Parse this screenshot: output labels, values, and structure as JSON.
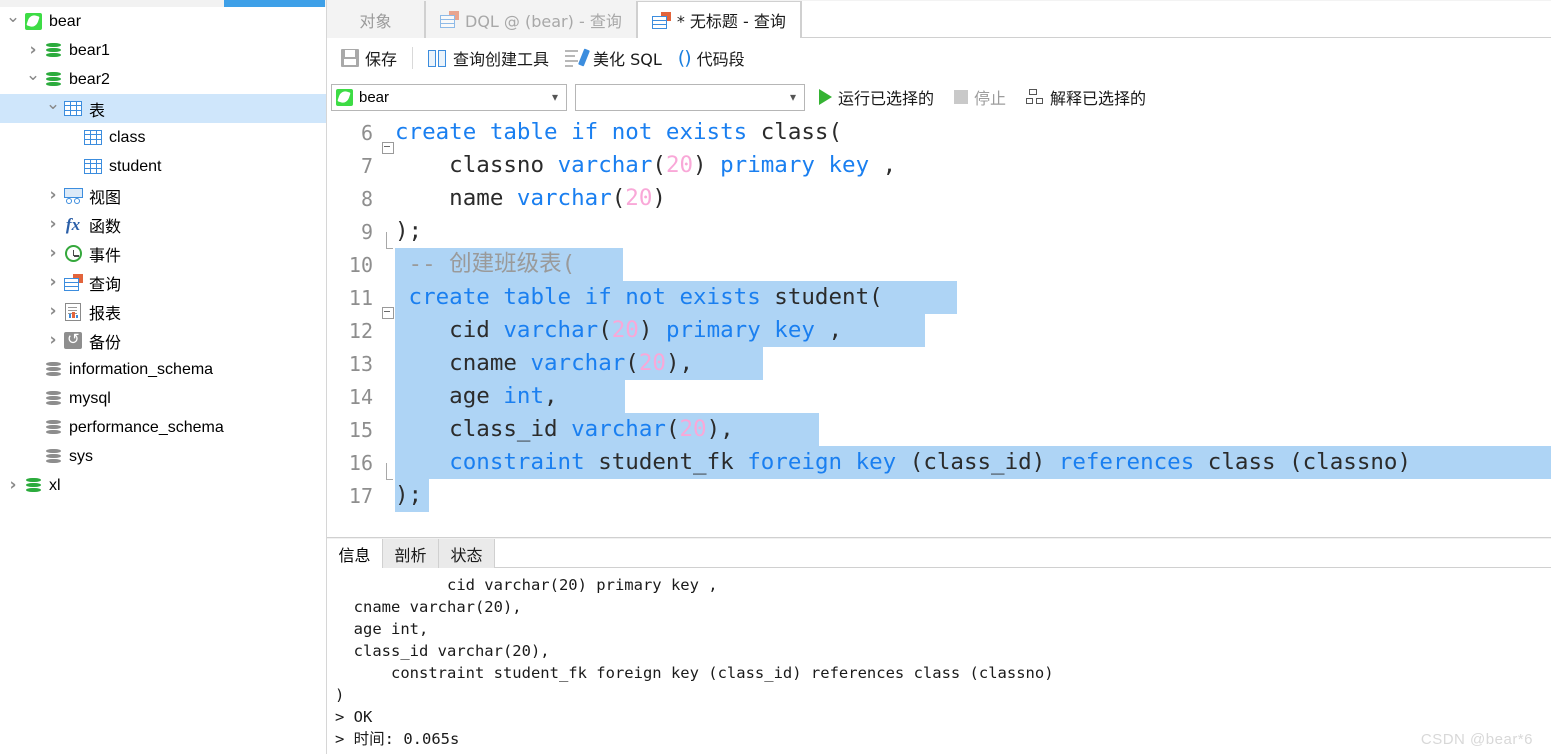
{
  "sidebar": {
    "scrollbar": {
      "name": "horizontal-scrollbar"
    },
    "items": [
      {
        "label": "bear",
        "icon": "dolphin-icon",
        "twist": "open",
        "indent": 0,
        "selected": false
      },
      {
        "label": "bear1",
        "icon": "database-green-icon",
        "twist": "closed",
        "indent": 1,
        "selected": false
      },
      {
        "label": "bear2",
        "icon": "database-green-icon",
        "twist": "open",
        "indent": 1,
        "selected": false
      },
      {
        "label": "表",
        "icon": "table-folder-icon",
        "twist": "open",
        "indent": 2,
        "selected": true
      },
      {
        "label": "class",
        "icon": "table-icon",
        "twist": "none",
        "indent": 3,
        "selected": false
      },
      {
        "label": "student",
        "icon": "table-icon",
        "twist": "none",
        "indent": 3,
        "selected": false
      },
      {
        "label": "视图",
        "icon": "view-icon",
        "twist": "closed",
        "indent": 2,
        "selected": false
      },
      {
        "label": "函数",
        "icon": "function-icon",
        "twist": "closed",
        "indent": 2,
        "selected": false
      },
      {
        "label": "事件",
        "icon": "event-clock-icon",
        "twist": "closed",
        "indent": 2,
        "selected": false
      },
      {
        "label": "查询",
        "icon": "query-icon",
        "twist": "closed",
        "indent": 2,
        "selected": false
      },
      {
        "label": "报表",
        "icon": "report-icon",
        "twist": "closed",
        "indent": 2,
        "selected": false
      },
      {
        "label": "备份",
        "icon": "backup-icon",
        "twist": "closed",
        "indent": 2,
        "selected": false
      },
      {
        "label": "information_schema",
        "icon": "database-gray-icon",
        "twist": "none",
        "indent": 1,
        "selected": false
      },
      {
        "label": "mysql",
        "icon": "database-gray-icon",
        "twist": "none",
        "indent": 1,
        "selected": false
      },
      {
        "label": "performance_schema",
        "icon": "database-gray-icon",
        "twist": "none",
        "indent": 1,
        "selected": false
      },
      {
        "label": "sys",
        "icon": "database-gray-icon",
        "twist": "none",
        "indent": 1,
        "selected": false
      },
      {
        "label": "xl",
        "icon": "database-green-icon",
        "twist": "closed",
        "indent": 0,
        "selected": false
      }
    ]
  },
  "tabs": [
    {
      "label": "对象",
      "icon": "none",
      "state": "objects"
    },
    {
      "label": "DQL @ (bear) - 查询",
      "icon": "query-icon",
      "state": "inactive"
    },
    {
      "label": "* 无标题 - 查询",
      "icon": "query-icon",
      "state": "active"
    }
  ],
  "toolbar": {
    "save_label": "保存",
    "query_builder_label": "查询创建工具",
    "beautify_label": "美化 SQL",
    "snippet_label": "代码段"
  },
  "connbar": {
    "connection_value": "bear",
    "database_value": "",
    "run_selected_label": "运行已选择的",
    "stop_label": "停止",
    "explain_selected_label": "解释已选择的"
  },
  "editor": {
    "first_line_number": 6,
    "lines": [
      {
        "n": 6,
        "fold": "box",
        "indent": 0,
        "tokens": [
          {
            "t": "create table if not exists ",
            "c": "kw"
          },
          {
            "t": "class(",
            "c": ""
          }
        ],
        "selected": false
      },
      {
        "n": 7,
        "fold": "bar",
        "indent": 0,
        "tokens": [
          {
            "t": "    classno ",
            "c": ""
          },
          {
            "t": "varchar",
            "c": "kw"
          },
          {
            "t": "(",
            "c": ""
          },
          {
            "t": "20",
            "c": "num"
          },
          {
            "t": ") ",
            "c": ""
          },
          {
            "t": "primary key",
            "c": "kw"
          },
          {
            "t": " ,",
            "c": ""
          }
        ],
        "selected": false
      },
      {
        "n": 8,
        "fold": "bar",
        "indent": 0,
        "tokens": [
          {
            "t": "    name ",
            "c": ""
          },
          {
            "t": "varchar",
            "c": "kw"
          },
          {
            "t": "(",
            "c": ""
          },
          {
            "t": "20",
            "c": "num"
          },
          {
            "t": ")",
            "c": ""
          }
        ],
        "selected": false
      },
      {
        "n": 9,
        "fold": "end",
        "indent": 0,
        "tokens": [
          {
            "t": ");",
            "c": ""
          }
        ],
        "selected": false
      },
      {
        "n": 10,
        "fold": "none",
        "indent": 0,
        "tokens": [
          {
            "t": " -- 创建班级表(",
            "c": "cmt"
          }
        ],
        "selected": true,
        "sel_width": 228
      },
      {
        "n": 11,
        "fold": "box",
        "indent": 0,
        "tokens": [
          {
            "t": " create table if not exists ",
            "c": "kw"
          },
          {
            "t": "student(",
            "c": ""
          }
        ],
        "selected": true,
        "sel_width": 562
      },
      {
        "n": 12,
        "fold": "bar",
        "indent": 0,
        "tokens": [
          {
            "t": "    cid ",
            "c": ""
          },
          {
            "t": "varchar",
            "c": "kw"
          },
          {
            "t": "(",
            "c": ""
          },
          {
            "t": "20",
            "c": "num"
          },
          {
            "t": ") ",
            "c": ""
          },
          {
            "t": "primary key",
            "c": "kw"
          },
          {
            "t": " ,",
            "c": ""
          }
        ],
        "selected": true,
        "sel_width": 530
      },
      {
        "n": 13,
        "fold": "bar",
        "indent": 0,
        "tokens": [
          {
            "t": "    cname ",
            "c": ""
          },
          {
            "t": "varchar",
            "c": "kw"
          },
          {
            "t": "(",
            "c": ""
          },
          {
            "t": "20",
            "c": "num"
          },
          {
            "t": "),",
            "c": ""
          }
        ],
        "selected": true,
        "sel_width": 368
      },
      {
        "n": 14,
        "fold": "bar",
        "indent": 0,
        "tokens": [
          {
            "t": "    age ",
            "c": ""
          },
          {
            "t": "int",
            "c": "kw"
          },
          {
            "t": ",",
            "c": ""
          }
        ],
        "selected": true,
        "sel_width": 230
      },
      {
        "n": 15,
        "fold": "bar",
        "indent": 0,
        "tokens": [
          {
            "t": "    class_id ",
            "c": ""
          },
          {
            "t": "varchar",
            "c": "kw"
          },
          {
            "t": "(",
            "c": ""
          },
          {
            "t": "20",
            "c": "num"
          },
          {
            "t": "),",
            "c": ""
          }
        ],
        "selected": true,
        "sel_width": 424
      },
      {
        "n": 16,
        "fold": "end",
        "indent": 0,
        "tokens": [
          {
            "t": "    ",
            "c": ""
          },
          {
            "t": "constraint",
            "c": "kw"
          },
          {
            "t": " student_fk ",
            "c": ""
          },
          {
            "t": "foreign key",
            "c": "kw"
          },
          {
            "t": " (class_id) ",
            "c": ""
          },
          {
            "t": "references",
            "c": "kw"
          },
          {
            "t": " class (classno)",
            "c": ""
          }
        ],
        "selected": true,
        "sel_width": 1160
      },
      {
        "n": 17,
        "fold": "none",
        "indent": 0,
        "tokens": [
          {
            "t": ");",
            "c": ""
          }
        ],
        "selected": true,
        "sel_width": 34
      }
    ]
  },
  "bottom": {
    "tabs": [
      {
        "label": "信息",
        "active": true
      },
      {
        "label": "剖析",
        "active": false
      },
      {
        "label": "状态",
        "active": false
      }
    ],
    "output_lines": [
      "            cid varchar(20) primary key ,",
      "  cname varchar(20),",
      "  age int,",
      "  class_id varchar(20),",
      "      constraint student_fk foreign key (class_id) references class (classno)",
      ")",
      "> OK",
      "> 时间: 0.065s"
    ]
  },
  "watermark": "CSDN @bear*6",
  "colors": {
    "selection": "#aed4f5",
    "keyword": "#1a7ff0",
    "number": "#f9a8d8",
    "comment": "#9a9a9a",
    "tree_selected": "#cfe6fb",
    "run_green": "#35b333",
    "scrollbar_blue": "#3ea0e8"
  }
}
